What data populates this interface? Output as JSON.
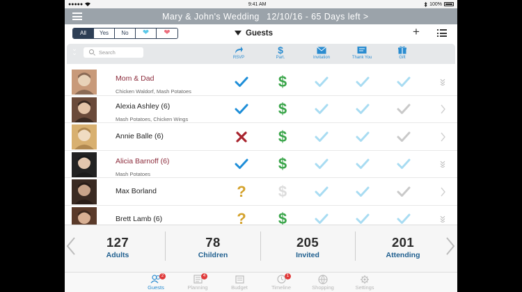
{
  "status_bar": {
    "time": "9:41 AM",
    "battery": "100%"
  },
  "nav": {
    "title": "Mary & John's Wedding",
    "date_info": "12/10/16 - 65 Days left >"
  },
  "filters": [
    {
      "label": "All",
      "active": true
    },
    {
      "label": "Yes",
      "active": false
    },
    {
      "label": "No",
      "active": false
    },
    {
      "icon": "blue-heart-icon",
      "color": "#5bc8e8"
    },
    {
      "icon": "pink-heart-icon",
      "color": "#ec6d7c"
    }
  ],
  "section_title": "Guests",
  "search": {
    "placeholder": "Search"
  },
  "columns": [
    {
      "label": "RSVP",
      "icon": "share-arrow-icon"
    },
    {
      "label": "Part.",
      "icon": "dollar-icon"
    },
    {
      "label": "Invitation",
      "icon": "invitation-icon"
    },
    {
      "label": "Thank You",
      "icon": "thank-you-card-icon"
    },
    {
      "label": "Gift",
      "icon": "gift-icon"
    }
  ],
  "guests": [
    {
      "name": "Mom & Dad",
      "highlight": true,
      "meal": "Chicken Waldorf, Mash Potatoes",
      "rsvp": "check",
      "paid": true,
      "invitation": true,
      "thank_you": true,
      "gift": true,
      "row_action": "expand"
    },
    {
      "name": "Alexia Ashley  (6)",
      "highlight": false,
      "meal": "Mash Potatoes, Chicken Wings",
      "rsvp": "check",
      "paid": true,
      "invitation": true,
      "thank_you": true,
      "gift": false,
      "row_action": "chevron"
    },
    {
      "name": "Annie Balle (6)",
      "highlight": false,
      "meal": "",
      "rsvp": "x",
      "paid": true,
      "invitation": true,
      "thank_you": true,
      "gift": false,
      "row_action": "chevron"
    },
    {
      "name": "Alicia Barnoff (6)",
      "highlight": true,
      "meal": "Mash Potatoes",
      "rsvp": "check",
      "paid": true,
      "invitation": true,
      "thank_you": true,
      "gift": true,
      "row_action": "expand"
    },
    {
      "name": "Max Borland",
      "highlight": false,
      "meal": "",
      "rsvp": "question",
      "paid": false,
      "invitation": true,
      "thank_you": true,
      "gift": false,
      "row_action": "chevron"
    },
    {
      "name": "Brett Lamb (6)",
      "highlight": false,
      "meal": "",
      "rsvp": "question",
      "paid": true,
      "invitation": true,
      "thank_you": true,
      "gift": true,
      "row_action": "expand"
    }
  ],
  "stats": [
    {
      "value": "127",
      "label": "Adults"
    },
    {
      "value": "78",
      "label": "Children"
    },
    {
      "value": "205",
      "label": "Invited"
    },
    {
      "value": "201",
      "label": "Attending"
    }
  ],
  "tabs": [
    {
      "label": "Guests",
      "icon": "guests-icon",
      "badge": "2",
      "active": true
    },
    {
      "label": "Planning",
      "icon": "planning-icon",
      "badge": "4",
      "active": false
    },
    {
      "label": "Budget",
      "icon": "budget-icon",
      "badge": "",
      "active": false
    },
    {
      "label": "Timeline",
      "icon": "timeline-icon",
      "badge": "1",
      "active": false
    },
    {
      "label": "Shopping",
      "icon": "shopping-icon",
      "badge": "",
      "active": false
    },
    {
      "label": "Settings",
      "icon": "settings-icon",
      "badge": "",
      "active": false
    }
  ],
  "colors": {
    "nav_bar": "#9ba3aa",
    "check_blue": "#1e8ed8",
    "light_check": "#a8dcf2",
    "gray_check": "#c9c9c9",
    "dollar_green": "#3aa54a",
    "question_gold": "#d4a22c",
    "x_red": "#a8242e",
    "stat_label": "#1f5f8f"
  }
}
